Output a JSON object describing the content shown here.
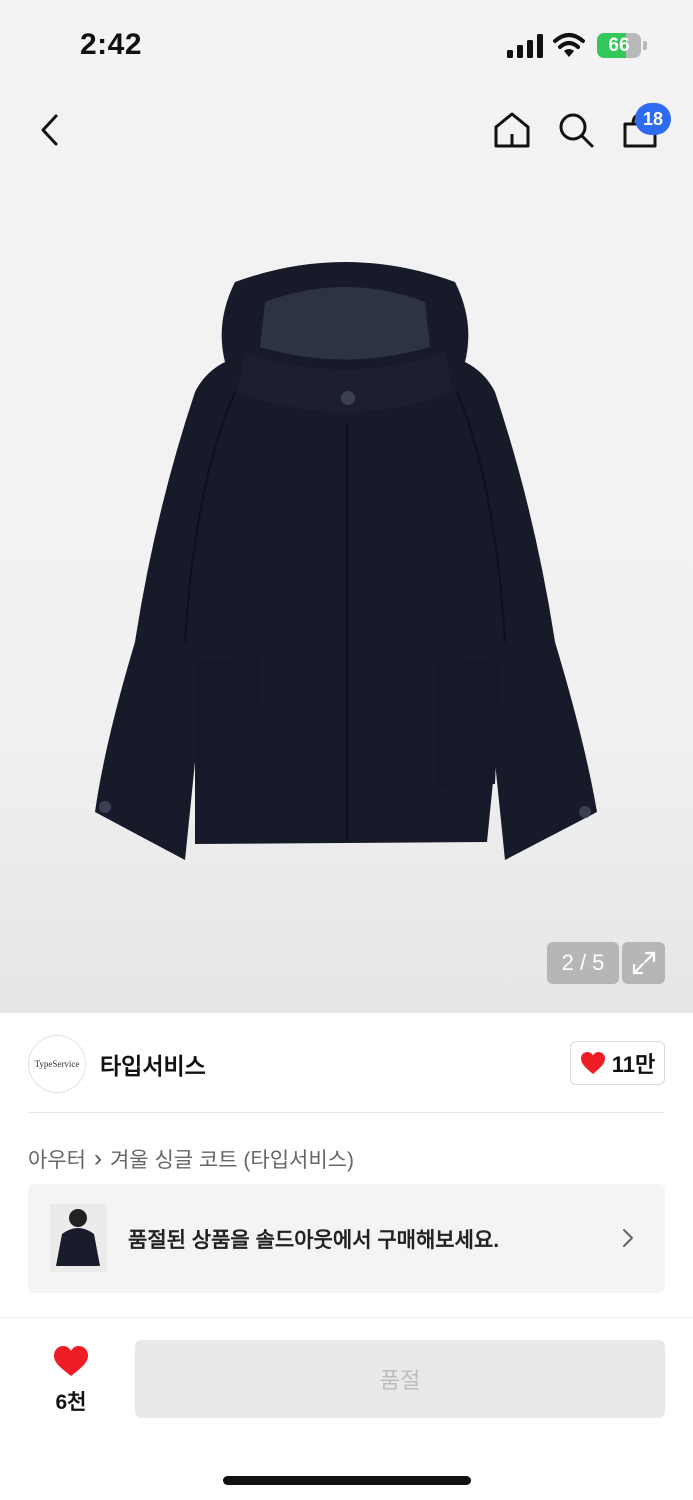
{
  "status_bar": {
    "time": "2:42",
    "battery_percent": "66",
    "battery_level": 0.66
  },
  "nav": {
    "back_icon": "chevron-left-icon",
    "home_icon": "home-icon",
    "search_icon": "search-icon",
    "bag_icon": "shopping-bag-icon",
    "bag_badge": "18",
    "badge_color": "#2f6bf2"
  },
  "gallery": {
    "counter": "2 / 5",
    "expand_icon": "expand-icon"
  },
  "brand": {
    "logo_text": "TypeService",
    "name": "타입서비스",
    "like_count": "11만"
  },
  "breadcrumb": {
    "category": "아우터",
    "separator": "›",
    "product": "겨울 싱글 코트 (타입서비스)"
  },
  "promo": {
    "text": "품절된 상품을 솔드아웃에서 구매해보세요."
  },
  "bottom_bar": {
    "like_count": "6천",
    "buy_label": "품절"
  },
  "colors": {
    "heart": "#ee1c25",
    "coat": "#161826"
  }
}
